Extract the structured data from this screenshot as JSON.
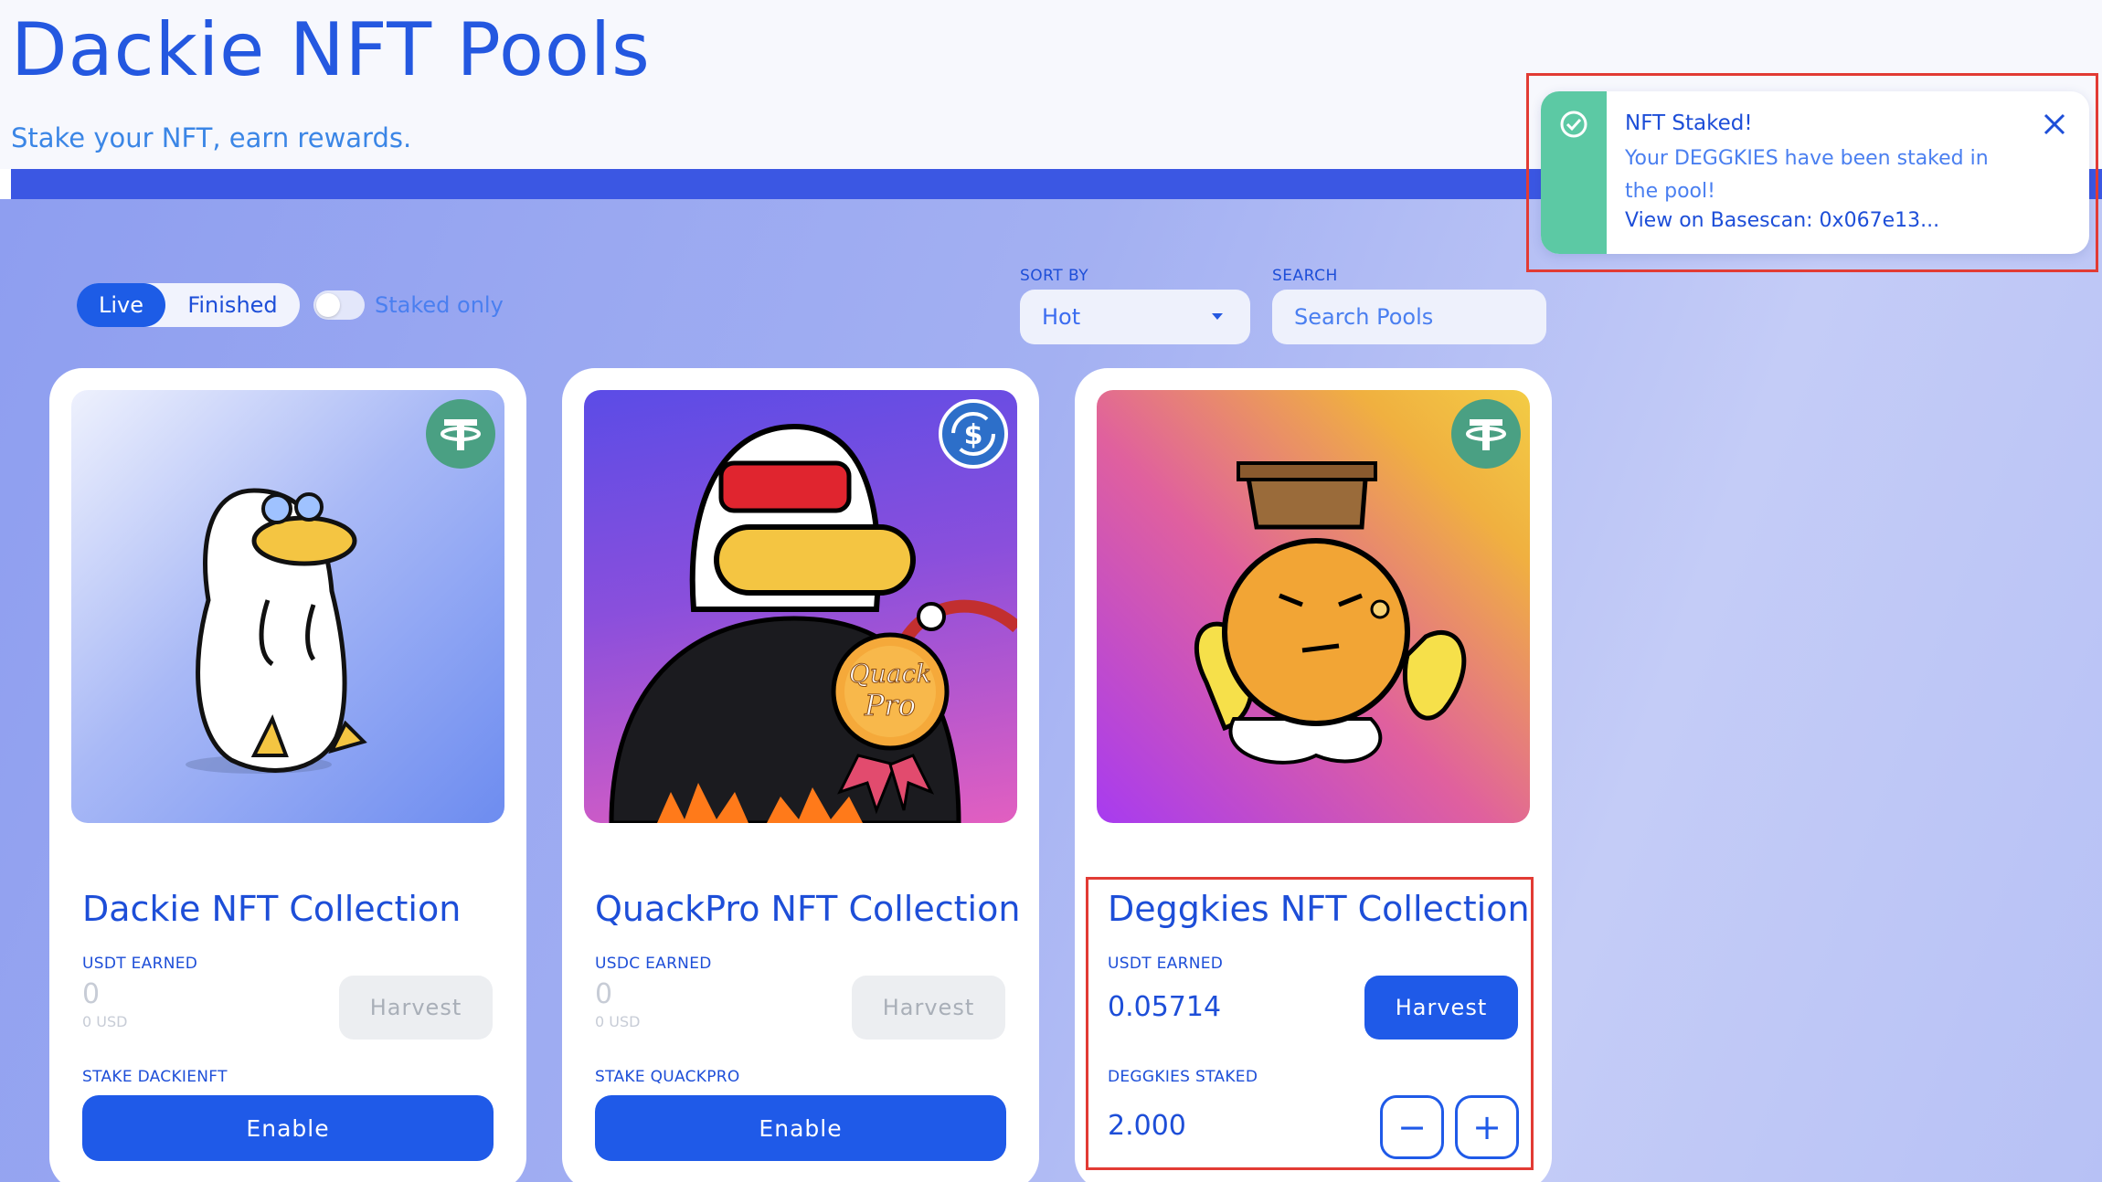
{
  "header": {
    "title": "Dackie NFT Pools",
    "subtitle": "Stake your NFT, earn rewards."
  },
  "filters": {
    "tabs": [
      "Live",
      "Finished"
    ],
    "active_tab": "Live",
    "staked_only_label": "Staked only",
    "staked_only": false,
    "sort_label": "SORT BY",
    "sort_value": "Hot",
    "search_label": "SEARCH",
    "search_placeholder": "Search Pools"
  },
  "pools": [
    {
      "title": "Dackie NFT Collection",
      "token_icon": "tether-icon",
      "earned_label": "USDT EARNED",
      "earned_value": "0",
      "earned_usd": "0 USD",
      "harvest_label": "Harvest",
      "stake_label": "STAKE DACKIENFT",
      "action_label": "Enable"
    },
    {
      "title": "QuackPro NFT Collection",
      "token_icon": "usdc-icon",
      "earned_label": "USDC EARNED",
      "earned_value": "0",
      "earned_usd": "0 USD",
      "harvest_label": "Harvest",
      "stake_label": "STAKE QUACKPRO",
      "action_label": "Enable",
      "badge_text": [
        "Quack",
        "Pro"
      ]
    },
    {
      "title": "Deggkies NFT Collection",
      "token_icon": "tether-icon",
      "earned_label": "USDT EARNED",
      "earned_value": "0.05714",
      "harvest_label": "Harvest",
      "staked_label": "DEGGKIES STAKED",
      "staked_value": "2.000",
      "minus_label": "−",
      "plus_label": "+"
    }
  ],
  "toast": {
    "title": "NFT Staked!",
    "message": "Your DEGGKIES have been staked in the pool!",
    "link": "View on Basescan: 0x067e13..."
  },
  "colors": {
    "primary": "#1f5ae8",
    "title_blue": "#2458e0",
    "success_green": "#5cc9a4",
    "highlight_red": "#e23b34",
    "tether_green": "#4aa083"
  }
}
